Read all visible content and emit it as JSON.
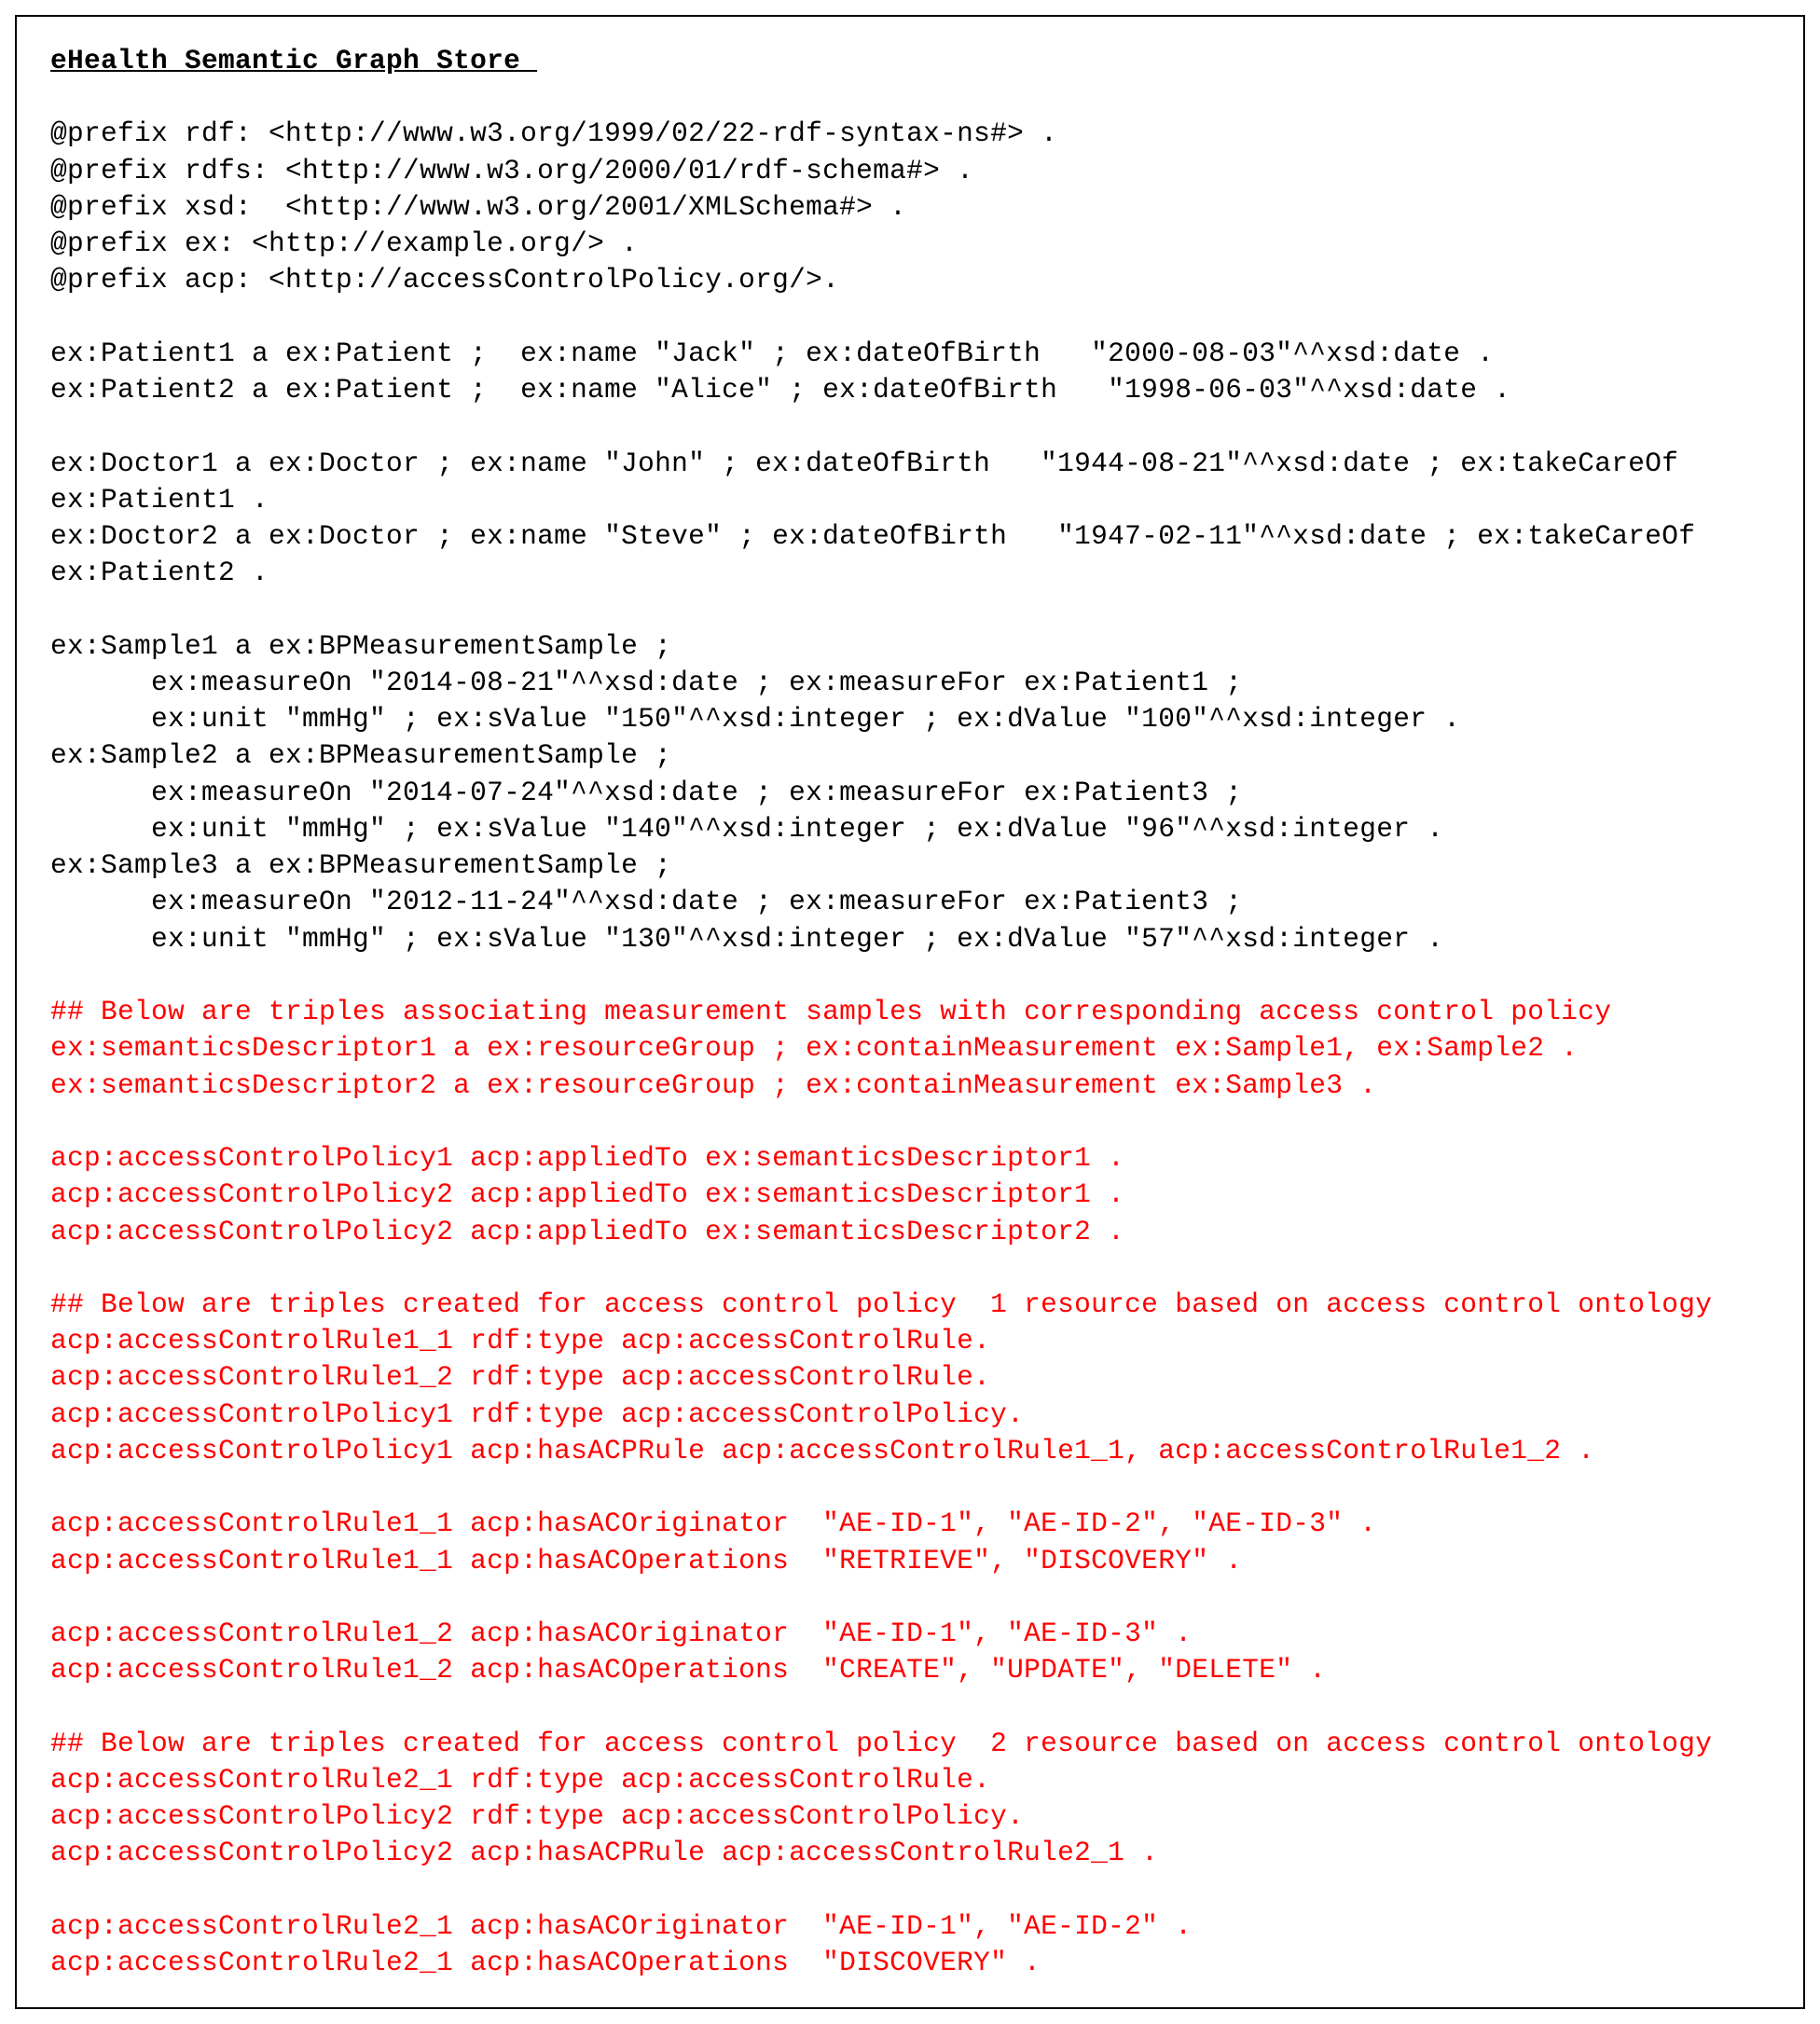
{
  "title": "eHealth Semantic Graph Store ",
  "blank": "",
  "p1": "@prefix rdf: <http://www.w3.org/1999/02/22-rdf-syntax-ns#> .",
  "p2": "@prefix rdfs: <http://www.w3.org/2000/01/rdf-schema#> .",
  "p3": "@prefix xsd:  <http://www.w3.org/2001/XMLSchema#> .",
  "p4": "@prefix ex: <http://example.org/> .",
  "p5": "@prefix acp: <http://accessControlPolicy.org/>.",
  "pt1": "ex:Patient1 a ex:Patient ;  ex:name \"Jack\" ; ex:dateOfBirth   \"2000-08-03\"^^xsd:date .",
  "pt2": "ex:Patient2 a ex:Patient ;  ex:name \"Alice\" ; ex:dateOfBirth   \"1998-06-03\"^^xsd:date .",
  "d1a": "ex:Doctor1 a ex:Doctor ; ex:name \"John\" ; ex:dateOfBirth   \"1944-08-21\"^^xsd:date ; ex:takeCareOf",
  "d1b": "ex:Patient1 .",
  "d2a": "ex:Doctor2 a ex:Doctor ; ex:name \"Steve\" ; ex:dateOfBirth   \"1947-02-11\"^^xsd:date ; ex:takeCareOf",
  "d2b": "ex:Patient2 .",
  "s1a": "ex:Sample1 a ex:BPMeasurementSample ;",
  "s1b": "      ex:measureOn \"2014-08-21\"^^xsd:date ; ex:measureFor ex:Patient1 ;",
  "s1c": "      ex:unit \"mmHg\" ; ex:sValue \"150\"^^xsd:integer ; ex:dValue \"100\"^^xsd:integer .",
  "s2a": "ex:Sample2 a ex:BPMeasurementSample ;",
  "s2b": "      ex:measureOn \"2014-07-24\"^^xsd:date ; ex:measureFor ex:Patient3 ;",
  "s2c": "      ex:unit \"mmHg\" ; ex:sValue \"140\"^^xsd:integer ; ex:dValue \"96\"^^xsd:integer .",
  "s3a": "ex:Sample3 a ex:BPMeasurementSample ;",
  "s3b": "      ex:measureOn \"2012-11-24\"^^xsd:date ; ex:measureFor ex:Patient3 ;",
  "s3c": "      ex:unit \"mmHg\" ; ex:sValue \"130\"^^xsd:integer ; ex:dValue \"57\"^^xsd:integer .",
  "r1": "## Below are triples associating measurement samples with corresponding access control policy",
  "r2": "ex:semanticsDescriptor1 a ex:resourceGroup ; ex:containMeasurement ex:Sample1, ex:Sample2 .",
  "r3": "ex:semanticsDescriptor2 a ex:resourceGroup ; ex:containMeasurement ex:Sample3 .",
  "r4": "acp:accessControlPolicy1 acp:appliedTo ex:semanticsDescriptor1 .",
  "r5": "acp:accessControlPolicy2 acp:appliedTo ex:semanticsDescriptor1 .",
  "r6": "acp:accessControlPolicy2 acp:appliedTo ex:semanticsDescriptor2 .",
  "r7": "## Below are triples created for access control policy  1 resource based on access control ontology",
  "r8": "acp:accessControlRule1_1 rdf:type acp:accessControlRule.",
  "r9": "acp:accessControlRule1_2 rdf:type acp:accessControlRule.",
  "r10": "acp:accessControlPolicy1 rdf:type acp:accessControlPolicy.",
  "r11": "acp:accessControlPolicy1 acp:hasACPRule acp:accessControlRule1_1, acp:accessControlRule1_2 .",
  "r12": "acp:accessControlRule1_1 acp:hasACOriginator  \"AE-ID-1\", \"AE-ID-2\", \"AE-ID-3\" .",
  "r13": "acp:accessControlRule1_1 acp:hasACOperations  \"RETRIEVE\", \"DISCOVERY\" .",
  "r14": "acp:accessControlRule1_2 acp:hasACOriginator  \"AE-ID-1\", \"AE-ID-3\" .",
  "r15": "acp:accessControlRule1_2 acp:hasACOperations  \"CREATE\", \"UPDATE\", \"DELETE\" .",
  "r16": "## Below are triples created for access control policy  2 resource based on access control ontology",
  "r17": "acp:accessControlRule2_1 rdf:type acp:accessControlRule.",
  "r18": "acp:accessControlPolicy2 rdf:type acp:accessControlPolicy.",
  "r19": "acp:accessControlPolicy2 acp:hasACPRule acp:accessControlRule2_1 .",
  "r20": "acp:accessControlRule2_1 acp:hasACOriginator  \"AE-ID-1\", \"AE-ID-2\" .",
  "r21": "acp:accessControlRule2_1 acp:hasACOperations  \"DISCOVERY\" ."
}
